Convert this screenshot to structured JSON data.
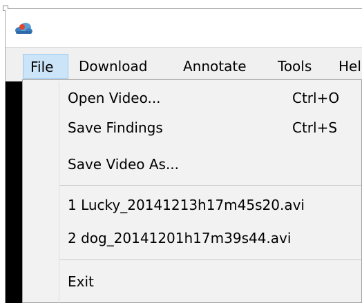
{
  "window": {
    "icon": "cloud-app-icon"
  },
  "menu_bar": {
    "items": [
      {
        "label": "File",
        "active": true
      },
      {
        "label": "Download",
        "active": false
      },
      {
        "label": "Annotate",
        "active": false
      },
      {
        "label": "Tools",
        "active": false
      },
      {
        "label": "Hel",
        "active": false
      }
    ]
  },
  "file_menu": {
    "items": [
      {
        "label": "Open Video...",
        "shortcut": "Ctrl+O"
      },
      {
        "label": "Save Findings",
        "shortcut": "Ctrl+S"
      },
      {
        "label": "Save Video As...",
        "shortcut": ""
      },
      {
        "label": "1 Lucky_20141213h17m45s20.avi",
        "shortcut": ""
      },
      {
        "label": "2 dog_20141201h17m39s44.avi",
        "shortcut": ""
      },
      {
        "label": "Exit",
        "shortcut": ""
      }
    ]
  },
  "colors": {
    "menu_bar_bg": "#f0f0f0",
    "active_menu_bg": "#cce4f7",
    "active_menu_border": "#99c9ef",
    "dropdown_bg": "#f2f2f2",
    "content_bg": "#000000"
  }
}
